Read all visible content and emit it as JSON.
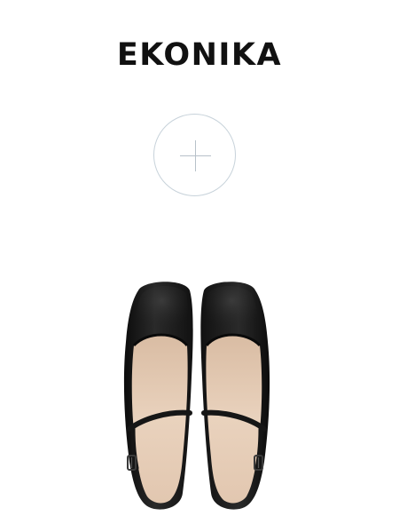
{
  "brand": {
    "name": "EKONIKA"
  },
  "add_button": {
    "icon": "plus-icon"
  },
  "product": {
    "image": "black-ballet-flats-with-ankle-strap",
    "colors": {
      "shoe": "#1a1a1a",
      "lining": "#e5cbb4"
    }
  }
}
